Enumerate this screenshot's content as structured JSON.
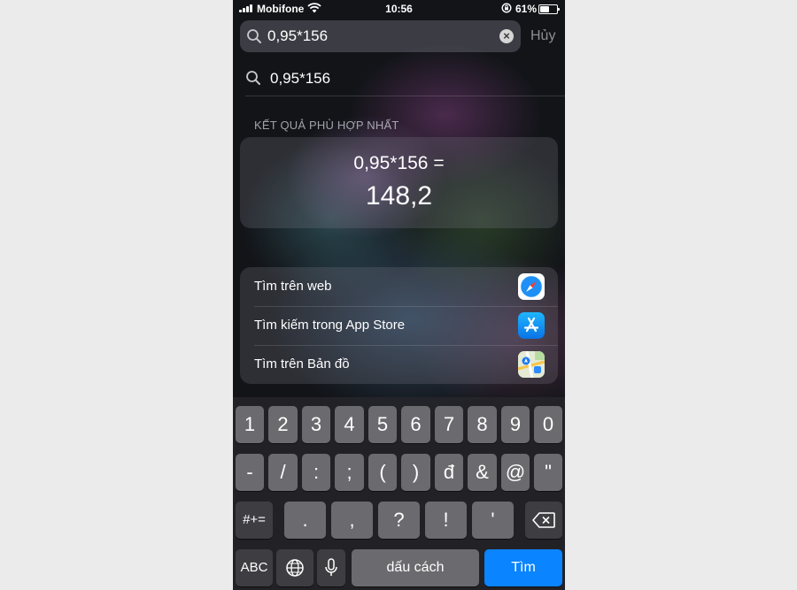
{
  "status_bar": {
    "carrier": "Mobifone",
    "time": "10:56",
    "battery_percent": "61%",
    "battery_level": 0.61
  },
  "search": {
    "query": "0,95*156",
    "cancel_label": "Hủy",
    "suggestion": "0,95*156"
  },
  "section_title": "KẾT QUẢ PHÙ HỢP NHẤT",
  "calculator": {
    "expression": "0,95*156 =",
    "result": "148,2"
  },
  "actions": [
    {
      "label": "Tìm trên web",
      "icon": "safari-icon"
    },
    {
      "label": "Tìm kiếm trong App Store",
      "icon": "app-store-icon"
    },
    {
      "label": "Tìm trên Bản đồ",
      "icon": "maps-icon"
    }
  ],
  "keyboard": {
    "row1": [
      "1",
      "2",
      "3",
      "4",
      "5",
      "6",
      "7",
      "8",
      "9",
      "0"
    ],
    "row2": [
      "-",
      "/",
      ":",
      ";",
      "(",
      ")",
      "đ",
      "&",
      "@",
      "\""
    ],
    "row3": {
      "mode": "#+=",
      "keys": [
        ".",
        ",",
        "?",
        "!",
        "'"
      ]
    },
    "row4": {
      "abc": "ABC",
      "space": "dấu cách",
      "return": "Tìm"
    }
  },
  "colors": {
    "accent": "#0a84ff",
    "key": "#6b6b6f",
    "key_dark": "#3e3e42"
  }
}
